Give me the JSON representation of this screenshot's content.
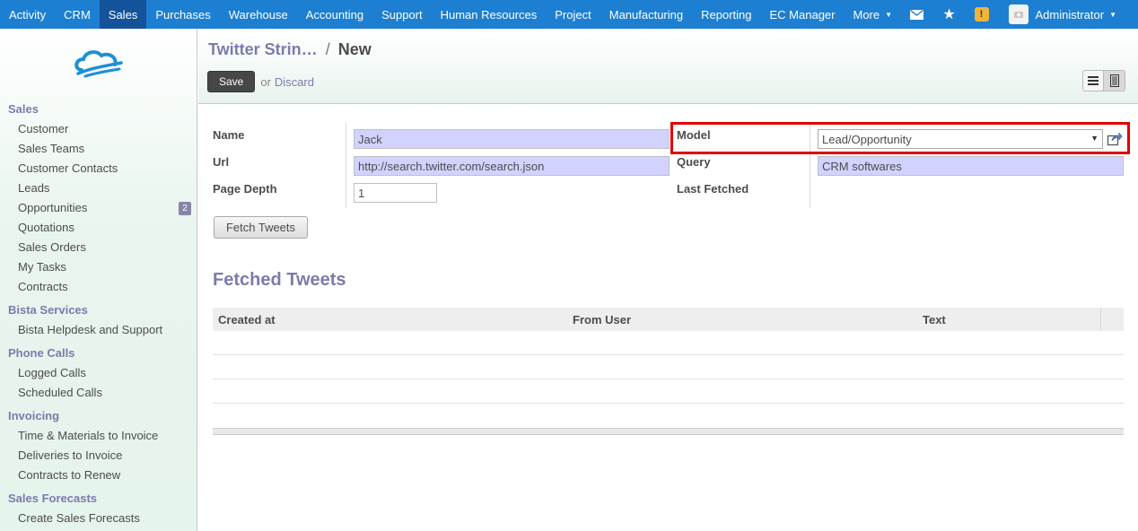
{
  "topbar": {
    "menu": [
      "Activity",
      "CRM",
      "Sales",
      "Purchases",
      "Warehouse",
      "Accounting",
      "Support",
      "Human Resources",
      "Project",
      "Manufacturing",
      "Reporting",
      "EC Manager",
      "More"
    ],
    "active": "Sales",
    "warning_badge": "!",
    "user": "Administrator",
    "colors": {
      "bar": "#1d7fd1",
      "active": "#14539a"
    }
  },
  "sidebar": {
    "sections": [
      {
        "title": "Sales",
        "items": [
          {
            "label": "Customer"
          },
          {
            "label": "Sales Teams"
          },
          {
            "label": "Customer Contacts"
          },
          {
            "label": "Leads"
          },
          {
            "label": "Opportunities",
            "badge": "2"
          },
          {
            "label": "Quotations"
          },
          {
            "label": "Sales Orders"
          },
          {
            "label": "My Tasks"
          },
          {
            "label": "Contracts"
          }
        ]
      },
      {
        "title": "Bista Services",
        "items": [
          {
            "label": "Bista Helpdesk and Support"
          }
        ]
      },
      {
        "title": "Phone Calls",
        "items": [
          {
            "label": "Logged Calls"
          },
          {
            "label": "Scheduled Calls"
          }
        ]
      },
      {
        "title": "Invoicing",
        "items": [
          {
            "label": "Time & Materials to Invoice"
          },
          {
            "label": "Deliveries to Invoice"
          },
          {
            "label": "Contracts to Renew"
          }
        ]
      },
      {
        "title": "Sales Forecasts",
        "items": [
          {
            "label": "Create Sales Forecasts"
          }
        ]
      }
    ]
  },
  "header": {
    "breadcrumb_link": "Twitter Strin…",
    "breadcrumb_sep": "/",
    "breadcrumb_current": "New",
    "save_label": "Save",
    "or_label": "or",
    "discard_label": "Discard"
  },
  "form": {
    "name_label": "Name",
    "name_value": "Jack",
    "url_label": "Url",
    "url_value": "http://search.twitter.com/search.json",
    "depth_label": "Page Depth",
    "depth_value": "1",
    "model_label": "Model",
    "model_value": "Lead/Opportunity",
    "query_label": "Query",
    "query_value": "CRM softwares",
    "last_fetched_label": "Last Fetched",
    "fetch_button": "Fetch Tweets",
    "section_title": "Fetched Tweets",
    "columns": [
      "Created at",
      "From User",
      "Text"
    ]
  }
}
